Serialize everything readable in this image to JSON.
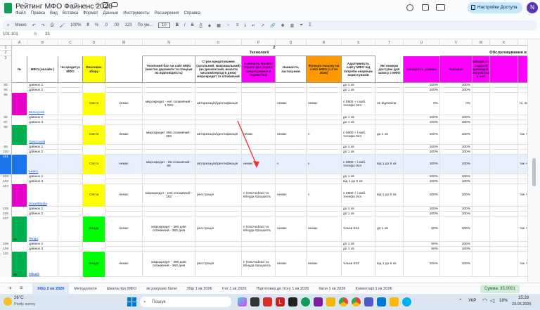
{
  "window": {
    "title": "Рейтинг МФО Файненс 2026",
    "menu": [
      "Файл",
      "Правка",
      "Вид",
      "Вставка",
      "Формат",
      "Данные",
      "Инструменты",
      "Расширения",
      "Справка"
    ],
    "access_button": "Настройки Доступа",
    "avatar_letter": "N"
  },
  "toolbar": {
    "menu_search": "Меню",
    "zoom": "100%",
    "currency": "₴",
    "percent": "%",
    "dec_less": ".0",
    "dec_more": ".00",
    "format": "123",
    "font": "По ум...",
    "font_size": "10"
  },
  "formula_bar": {
    "name_box": "101:101",
    "fx": "fx",
    "value": "33"
  },
  "columns": [
    {
      "label": "",
      "w": 17
    },
    {
      "label": "A",
      "w": 22
    },
    {
      "label": "B",
      "w": 44
    },
    {
      "label": "C",
      "w": 35
    },
    {
      "label": "D",
      "w": 32
    },
    {
      "label": "M",
      "w": 53
    },
    {
      "label": "N",
      "w": 75
    },
    {
      "label": "O",
      "w": 66
    },
    {
      "label": "P",
      "w": 48
    },
    {
      "label": "Q",
      "w": 44
    },
    {
      "label": "R",
      "w": 50
    },
    {
      "label": "S",
      "w": 48
    },
    {
      "label": "T",
      "w": 40
    },
    {
      "label": "U",
      "w": 52
    },
    {
      "label": "V",
      "w": 46
    },
    {
      "label": "W",
      "w": 25
    },
    {
      "label": "X",
      "w": 40
    },
    {
      "label": "Y",
      "w": 48
    },
    {
      "label": "Z",
      "w": 56
    },
    {
      "label": "AA",
      "w": 48
    }
  ],
  "header_rows": [
    "1",
    "2",
    "3"
  ],
  "header": {
    "row1": {
      "group_z": "Z",
      "group_3": "3"
    },
    "row2": {
      "tech": "Технології",
      "service": "Обслуговування в КЦ та канали підтримки"
    },
    "row3": [
      "№",
      "МФО (онлайн )",
      "Чи кредитує МФО",
      "Висновок збору",
      "",
      "Технічний бал чи сайт МФО (маєтно дерамити та спеціам на відповідність)",
      "Строк кредитування (загальний, максимальний) (не дисконтний, вказати числом/період в днях) мікрокредит та споживчий",
      "Наявність BankID/ Україні Дія (сервіс кредитування в Україні КЦ)",
      "Наявність застосунків",
      "Функція Пошуку на сайті МФО (з 2 кв 2026)",
      "Адаптивність сайту МФО під потреби незрячих користувачів",
      "Які номери доступні для запису з МФО",
      "Швидкість дзвінка",
      "Фактичні",
      "Швидкість надання вдповідей / консультація в чаті",
      "",
      "Середнє",
      "На якому сайті МФО (знайти 10-60 с форма, 20 м 71 м)",
      "Чи можна до запитань в КЦ"
    ]
  },
  "rows": [
    {
      "n": "93",
      "b": "",
      "sub": "дзвінок 2",
      "p": "",
      "t": "до 1 хв",
      "u": "100%",
      "w": "100%",
      "color": "#ffffff",
      "d_color": "#ffffff",
      "h": 7
    },
    {
      "n": "94",
      "b": "",
      "sub": "дзвінок 3",
      "p": "",
      "t": "до 1 хв",
      "u": "100%",
      "w": "100%",
      "color": "#ffffff",
      "d_color": "#ffffff",
      "h": 7
    },
    {
      "n": "95",
      "b": "MoneyVeil",
      "sub": "",
      "c": "немає",
      "d": "Свєта",
      "m": "мікрокредит - нет споживчий - 1 925",
      "p": "авторизація/ідентифікація",
      "r": "немає",
      "s": "немає",
      "t": "є 0800 + і моб. телефо 044",
      "tt": "не відповіли",
      "u": "0%",
      "w": "0%",
      "z": "ні, лише до 10",
      "a": "ні",
      "color": "#ffffff",
      "d_color": "#ffff00",
      "accent": "#e600c8",
      "h": 32
    },
    {
      "n": "96",
      "b": "",
      "sub": "дзвінок 2",
      "t": "до 1 хв",
      "u": "100%",
      "w": "100%",
      "color": "#ffffff",
      "d_color": "#ffffff",
      "h": 7
    },
    {
      "n": "97",
      "b": "",
      "sub": "дзвінок 3",
      "t": "до 1 хв",
      "u": "100%",
      "w": "100%",
      "color": "#ffffff",
      "d_color": "#ffffff",
      "h": 7
    },
    {
      "n": "98",
      "b": "ТойсCredit",
      "sub": "",
      "c": "немає",
      "d": "Свєта",
      "m": "мікрокредит 366 споживчий - 366",
      "p": "авторизація/ідентифікація",
      "q": "немає",
      "r": "немає",
      "s": "є",
      "t": "є 0800 + і моб. телефо 044",
      "tt": "до 1 хв",
      "u": "100%",
      "w": "100%",
      "z": "так + скрін з сайту",
      "aa": "так, в КЦ підтвердили",
      "color": "#ffffff",
      "d_color": "#ffff00",
      "accent": "#00b050",
      "h": 28
    },
    {
      "n": "99",
      "b": "",
      "sub": "дзвінок 2",
      "t": "до 1 хв",
      "u": "100%",
      "w": "100%",
      "color": "#ffffff",
      "d_color": "#ffffff",
      "h": 7
    },
    {
      "n": "100",
      "b": "",
      "sub": "дзвінок 3",
      "t": "до 1 хв",
      "u": "100%",
      "w": "100%",
      "color": "#ffffff",
      "d_color": "#ffffff",
      "h": 7
    },
    {
      "n": "101",
      "b": "Lean+",
      "sub": "",
      "c": "немає",
      "d": "Свєта",
      "m": "мікрокредит - 65 споживчий - 65",
      "p": "авторизація/ідентифікація",
      "q": "немає",
      "r": "є",
      "s": "є",
      "t": "є 0800 + і моб. телефо 044",
      "tt": "від 1 до 5 хв",
      "u": "100%",
      "w": "100%",
      "z": "так + скрін з сайту",
      "aa": "так, в КЦ підтверди",
      "color": "#e8f0fe",
      "d_color": "#ffff00",
      "accent": "#1a73e8",
      "h": 28,
      "selected": true
    },
    {
      "n": "102",
      "b": "",
      "sub": "дзвінок 2",
      "t": "до 1 хв",
      "u": "100%",
      "w": "100%",
      "color": "#ffffff",
      "d_color": "#ffffff",
      "h": 7
    },
    {
      "n": "103",
      "b": "",
      "sub": "дзвінок 3",
      "t": "від 1 до 5 хв",
      "u": "100%",
      "w": "100%",
      "color": "#ffffff",
      "d_color": "#ffffff",
      "h": 7
    },
    {
      "n": "104",
      "b": "SmartMedia",
      "sub": "",
      "c": "немає",
      "d": "Свєта",
      "m": "мікрокредит - 102 споживчий - 182",
      "p": "реєстрація",
      "q": "є IOS/Android та вбнуда працюють",
      "r": "немає",
      "s": "є",
      "t": "є 0800 + і моб. телефо 044",
      "tt": "від 1 до 5 хв",
      "u": "100%",
      "w": "100%",
      "z": "так + скрін з сайту",
      "aa": "так, в КЦ підтверди",
      "color": "#ffffff",
      "d_color": "#ffff00",
      "accent": "#e600c8",
      "h": 32
    },
    {
      "n": "105",
      "b": "",
      "sub": "дзвінок 2",
      "t": "до 1 хв",
      "u": "100%",
      "w": "100%",
      "color": "#ffffff",
      "d_color": "#ffffff",
      "h": 7
    },
    {
      "n": "106",
      "b": "",
      "sub": "дзвінок 3",
      "t": "до 1 хв",
      "u": "100%",
      "w": "100%",
      "color": "#ffffff",
      "d_color": "#ffffff",
      "h": 7
    },
    {
      "n": "107",
      "b": "Tengo",
      "num": "35",
      "sub": "",
      "c": "немає",
      "d": "Влада",
      "m": "мікрокредит - 360 днів споживчий - 360 днів",
      "p": "реєстрація",
      "q": "є IOS/Android та вбнуда працюють",
      "r": "немає",
      "s": "немає",
      "t": "тільки 044",
      "tt": "до 1 хв",
      "u": "50%",
      "w": "100%",
      "z": "так + скрін з сайту",
      "aa": "так, в КЦ підтверди",
      "color": "#ffffff",
      "d_color": "#00ff00",
      "accent": "#00b050",
      "h": 36
    },
    {
      "n": "108",
      "b": "",
      "sub": "дзвінок 2",
      "t": "до 1 хв",
      "u": "50%",
      "w": "100%",
      "color": "#ffffff",
      "d_color": "#ffffff",
      "h": 7
    },
    {
      "n": "109",
      "b": "",
      "sub": "дзвінок 3",
      "t": "до 1 хв",
      "u": "50%",
      "w": "100%",
      "color": "#ffffff",
      "d_color": "#ffffff",
      "h": 7
    },
    {
      "n": "110",
      "b": "Mikash",
      "num": "36",
      "sub": "",
      "c": "немає",
      "d": "Влада",
      "m": "мікрокредит - 360 днів споживчий - 360 днів",
      "p": "реєстрація",
      "q": "є IOS/Android та вбнуда працюють",
      "r": "немає",
      "s": "немає",
      "t": "тільки 044",
      "tt": "від 1 до 5 хв",
      "u": "100%",
      "w": "100%",
      "z": "так + скрін з сайту",
      "aa": "так, в КЦ підтверди",
      "color": "#ffffff",
      "d_color": "#00ff00",
      "accent": "#00b050",
      "h": 36
    }
  ],
  "tabs": [
    {
      "label": "Збір 2 кв 2026",
      "active": true
    },
    {
      "label": "Методологія",
      "active": false
    },
    {
      "label": "Шкала про МФО",
      "active": false
    },
    {
      "label": "як рахуємо бали",
      "active": false
    },
    {
      "label": "Збір 1 кв 2026",
      "active": false
    },
    {
      "label": "Ітог 1 кв 2026",
      "active": false
    },
    {
      "label": "Підготовка до Ітогу 1 кв 2026",
      "active": false
    },
    {
      "label": "бали 1 кв 2026",
      "active": false
    },
    {
      "label": "Коментарі 1 кв 2026",
      "active": false
    }
  ],
  "sum_badge": "Сумма: 35,0001",
  "taskbar": {
    "weather_temp": "26°C",
    "weather_desc": "Partly sunny",
    "search": "Пошук",
    "lang": "УКР",
    "time": "15:28",
    "date": "23.06.2026",
    "battery": "18%"
  }
}
